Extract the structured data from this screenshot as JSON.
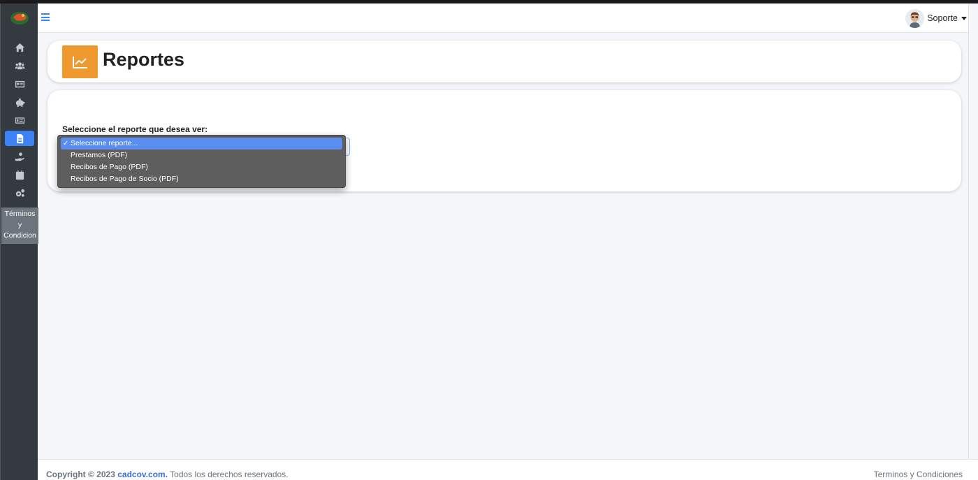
{
  "topbar": {
    "user_name": "Soporte"
  },
  "sidebar": {
    "items": [
      {
        "icon": "home-icon"
      },
      {
        "icon": "users-icon"
      },
      {
        "icon": "id-card-icon"
      },
      {
        "icon": "piggy-bank-icon"
      },
      {
        "icon": "money-check-icon"
      },
      {
        "icon": "file-icon",
        "active": true
      },
      {
        "icon": "hand-holding-icon"
      },
      {
        "icon": "calendar-icon"
      },
      {
        "icon": "cogs-icon"
      }
    ],
    "terms_line1": "Términos",
    "terms_line2": "y",
    "terms_line3": "Condicion"
  },
  "page": {
    "title": "Reportes",
    "icon": "chart-line-icon",
    "icon_color": "#ef9a2e"
  },
  "form": {
    "label": "Seleccione el reporte que desea ver:",
    "options": [
      "Seleccione reporte...",
      "Prestamos (PDF)",
      "Recibos de Pago (PDF)",
      "Recibos de Pago de Socio (PDF)"
    ],
    "selected_index": 0,
    "check_mark": "✓"
  },
  "footer": {
    "copyright": "Copyright © 2023",
    "brand": "cadcov.com.",
    "rights": "Todos los derechos reservados.",
    "terms_link": "Terminos y Condiciones"
  },
  "colors": {
    "accent": "#3b82f6",
    "sidebar_bg": "#343a40"
  }
}
